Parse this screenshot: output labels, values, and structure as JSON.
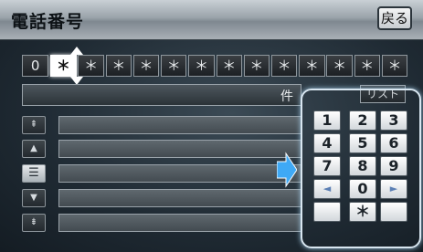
{
  "header": {
    "title": "電話番号",
    "back_label": "戻る"
  },
  "digits": [
    "0",
    "＊",
    "＊",
    "＊",
    "＊",
    "＊",
    "＊",
    "＊",
    "＊",
    "＊",
    "＊",
    "＊",
    "＊",
    "＊"
  ],
  "result": {
    "count_label": "件",
    "list_label": "リスト"
  },
  "side": {
    "page_up": "⇞",
    "up": "▲",
    "menu": "☰",
    "down": "▼",
    "page_down": "⇟"
  },
  "keypad": {
    "keys": [
      "1",
      "2",
      "3",
      "4",
      "5",
      "6",
      "7",
      "8",
      "9",
      "◄",
      "0",
      "►",
      "",
      "＊",
      ""
    ]
  },
  "colors": {
    "accent": "#3fa9f5",
    "keypad_border": "#d8e6f0"
  }
}
